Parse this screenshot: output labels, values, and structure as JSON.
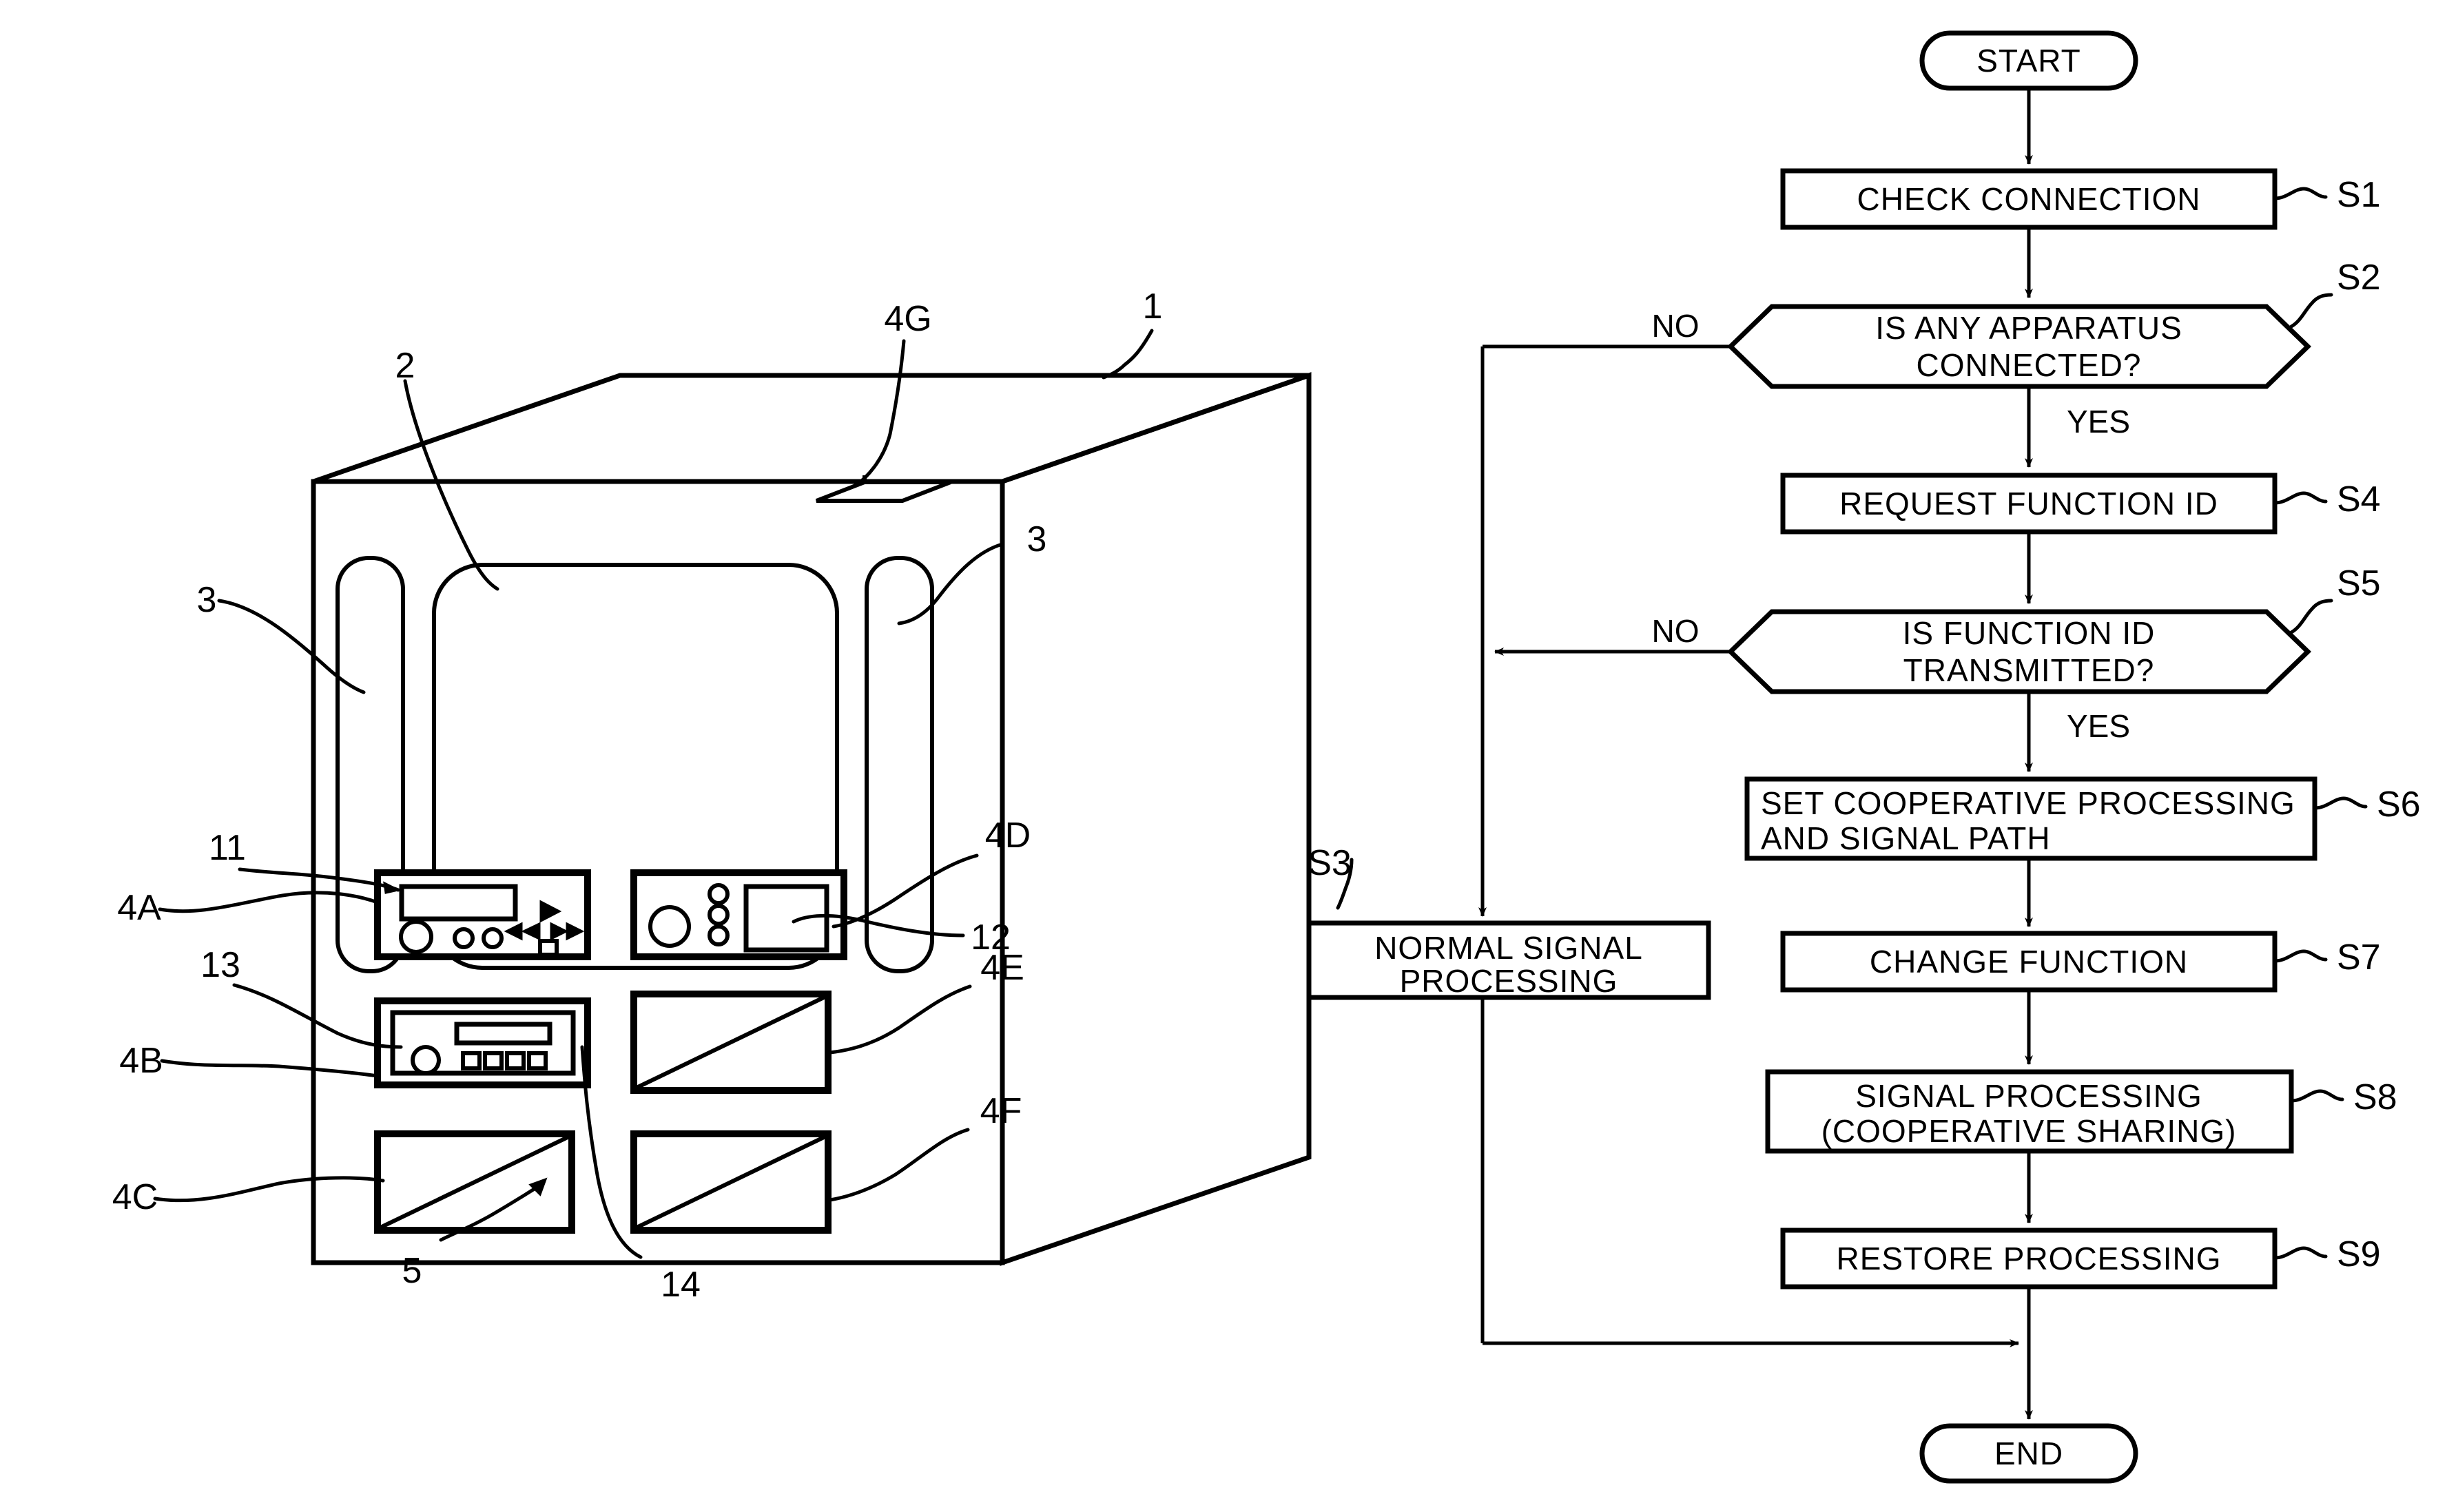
{
  "figure": {
    "type": "patent-drawing",
    "panels": [
      "apparatus-perspective-view",
      "process-flowchart"
    ]
  },
  "apparatus": {
    "title": "",
    "reference_numerals": [
      {
        "id": "num-1",
        "label": "1"
      },
      {
        "id": "num-2",
        "label": "2"
      },
      {
        "id": "num-3-left",
        "label": "3"
      },
      {
        "id": "num-3-right",
        "label": "3"
      },
      {
        "id": "num-4g",
        "label": "4G"
      },
      {
        "id": "num-4a",
        "label": "4A"
      },
      {
        "id": "num-4b",
        "label": "4B"
      },
      {
        "id": "num-4c",
        "label": "4C"
      },
      {
        "id": "num-4d",
        "label": "4D"
      },
      {
        "id": "num-4e",
        "label": "4E"
      },
      {
        "id": "num-4f",
        "label": "4F"
      },
      {
        "id": "num-5",
        "label": "5"
      },
      {
        "id": "num-11",
        "label": "11"
      },
      {
        "id": "num-12",
        "label": "12"
      },
      {
        "id": "num-13",
        "label": "13"
      },
      {
        "id": "num-14",
        "label": "14"
      }
    ],
    "labels": {
      "cabinet": "1",
      "main_display": "2",
      "side_vent_left": "3",
      "side_vent_right": "3",
      "top_connector": "4G",
      "slot_4a": "4A",
      "slot_4b": "4B",
      "slot_4c": "4C",
      "slot_4d": "4D",
      "slot_4e": "4E",
      "slot_4f": "4F",
      "blank_panel": "5",
      "device_11": "11",
      "device_12": "12",
      "device_13": "13",
      "device_14": "14"
    }
  },
  "flowchart": {
    "type": "process-flow",
    "terminals": {
      "start": "START",
      "end": "END"
    },
    "branch_labels": {
      "no": "NO",
      "yes": "YES"
    },
    "nodes": [
      {
        "id": "s1",
        "shape": "process",
        "text": "CHECK CONNECTION",
        "step": "S1"
      },
      {
        "id": "s2",
        "shape": "decision",
        "line1": "IS ANY APPARATUS",
        "line2": "CONNECTED?",
        "step": "S2"
      },
      {
        "id": "s3",
        "shape": "process",
        "line1": "NORMAL SIGNAL",
        "line2": "PROCESSING",
        "step": "S3"
      },
      {
        "id": "s4",
        "shape": "process",
        "text": "REQUEST FUNCTION ID",
        "step": "S4"
      },
      {
        "id": "s5",
        "shape": "decision",
        "line1": "IS FUNCTION ID",
        "line2": "TRANSMITTED?",
        "step": "S5"
      },
      {
        "id": "s6",
        "shape": "process",
        "line1": "SET COOPERATIVE PROCESSING",
        "line2": "AND SIGNAL PATH",
        "step": "S6"
      },
      {
        "id": "s7",
        "shape": "process",
        "text": "CHANGE FUNCTION",
        "step": "S7"
      },
      {
        "id": "s8",
        "shape": "process",
        "line1": "SIGNAL PROCESSING",
        "line2": "(COOPERATIVE SHARING)",
        "step": "S8"
      },
      {
        "id": "s9",
        "shape": "process",
        "text": "RESTORE PROCESSING",
        "step": "S9"
      }
    ],
    "step_refs": {
      "s1": "S1",
      "s2": "S2",
      "s3": "S3",
      "s4": "S4",
      "s5": "S5",
      "s6": "S6",
      "s7": "S7",
      "s8": "S8",
      "s9": "S9"
    },
    "branch_instances": {
      "s2_no": "NO",
      "s2_yes": "YES",
      "s5_no": "NO",
      "s5_yes": "YES"
    }
  },
  "colors": {
    "ink": "#000000",
    "paper": "#ffffff"
  }
}
